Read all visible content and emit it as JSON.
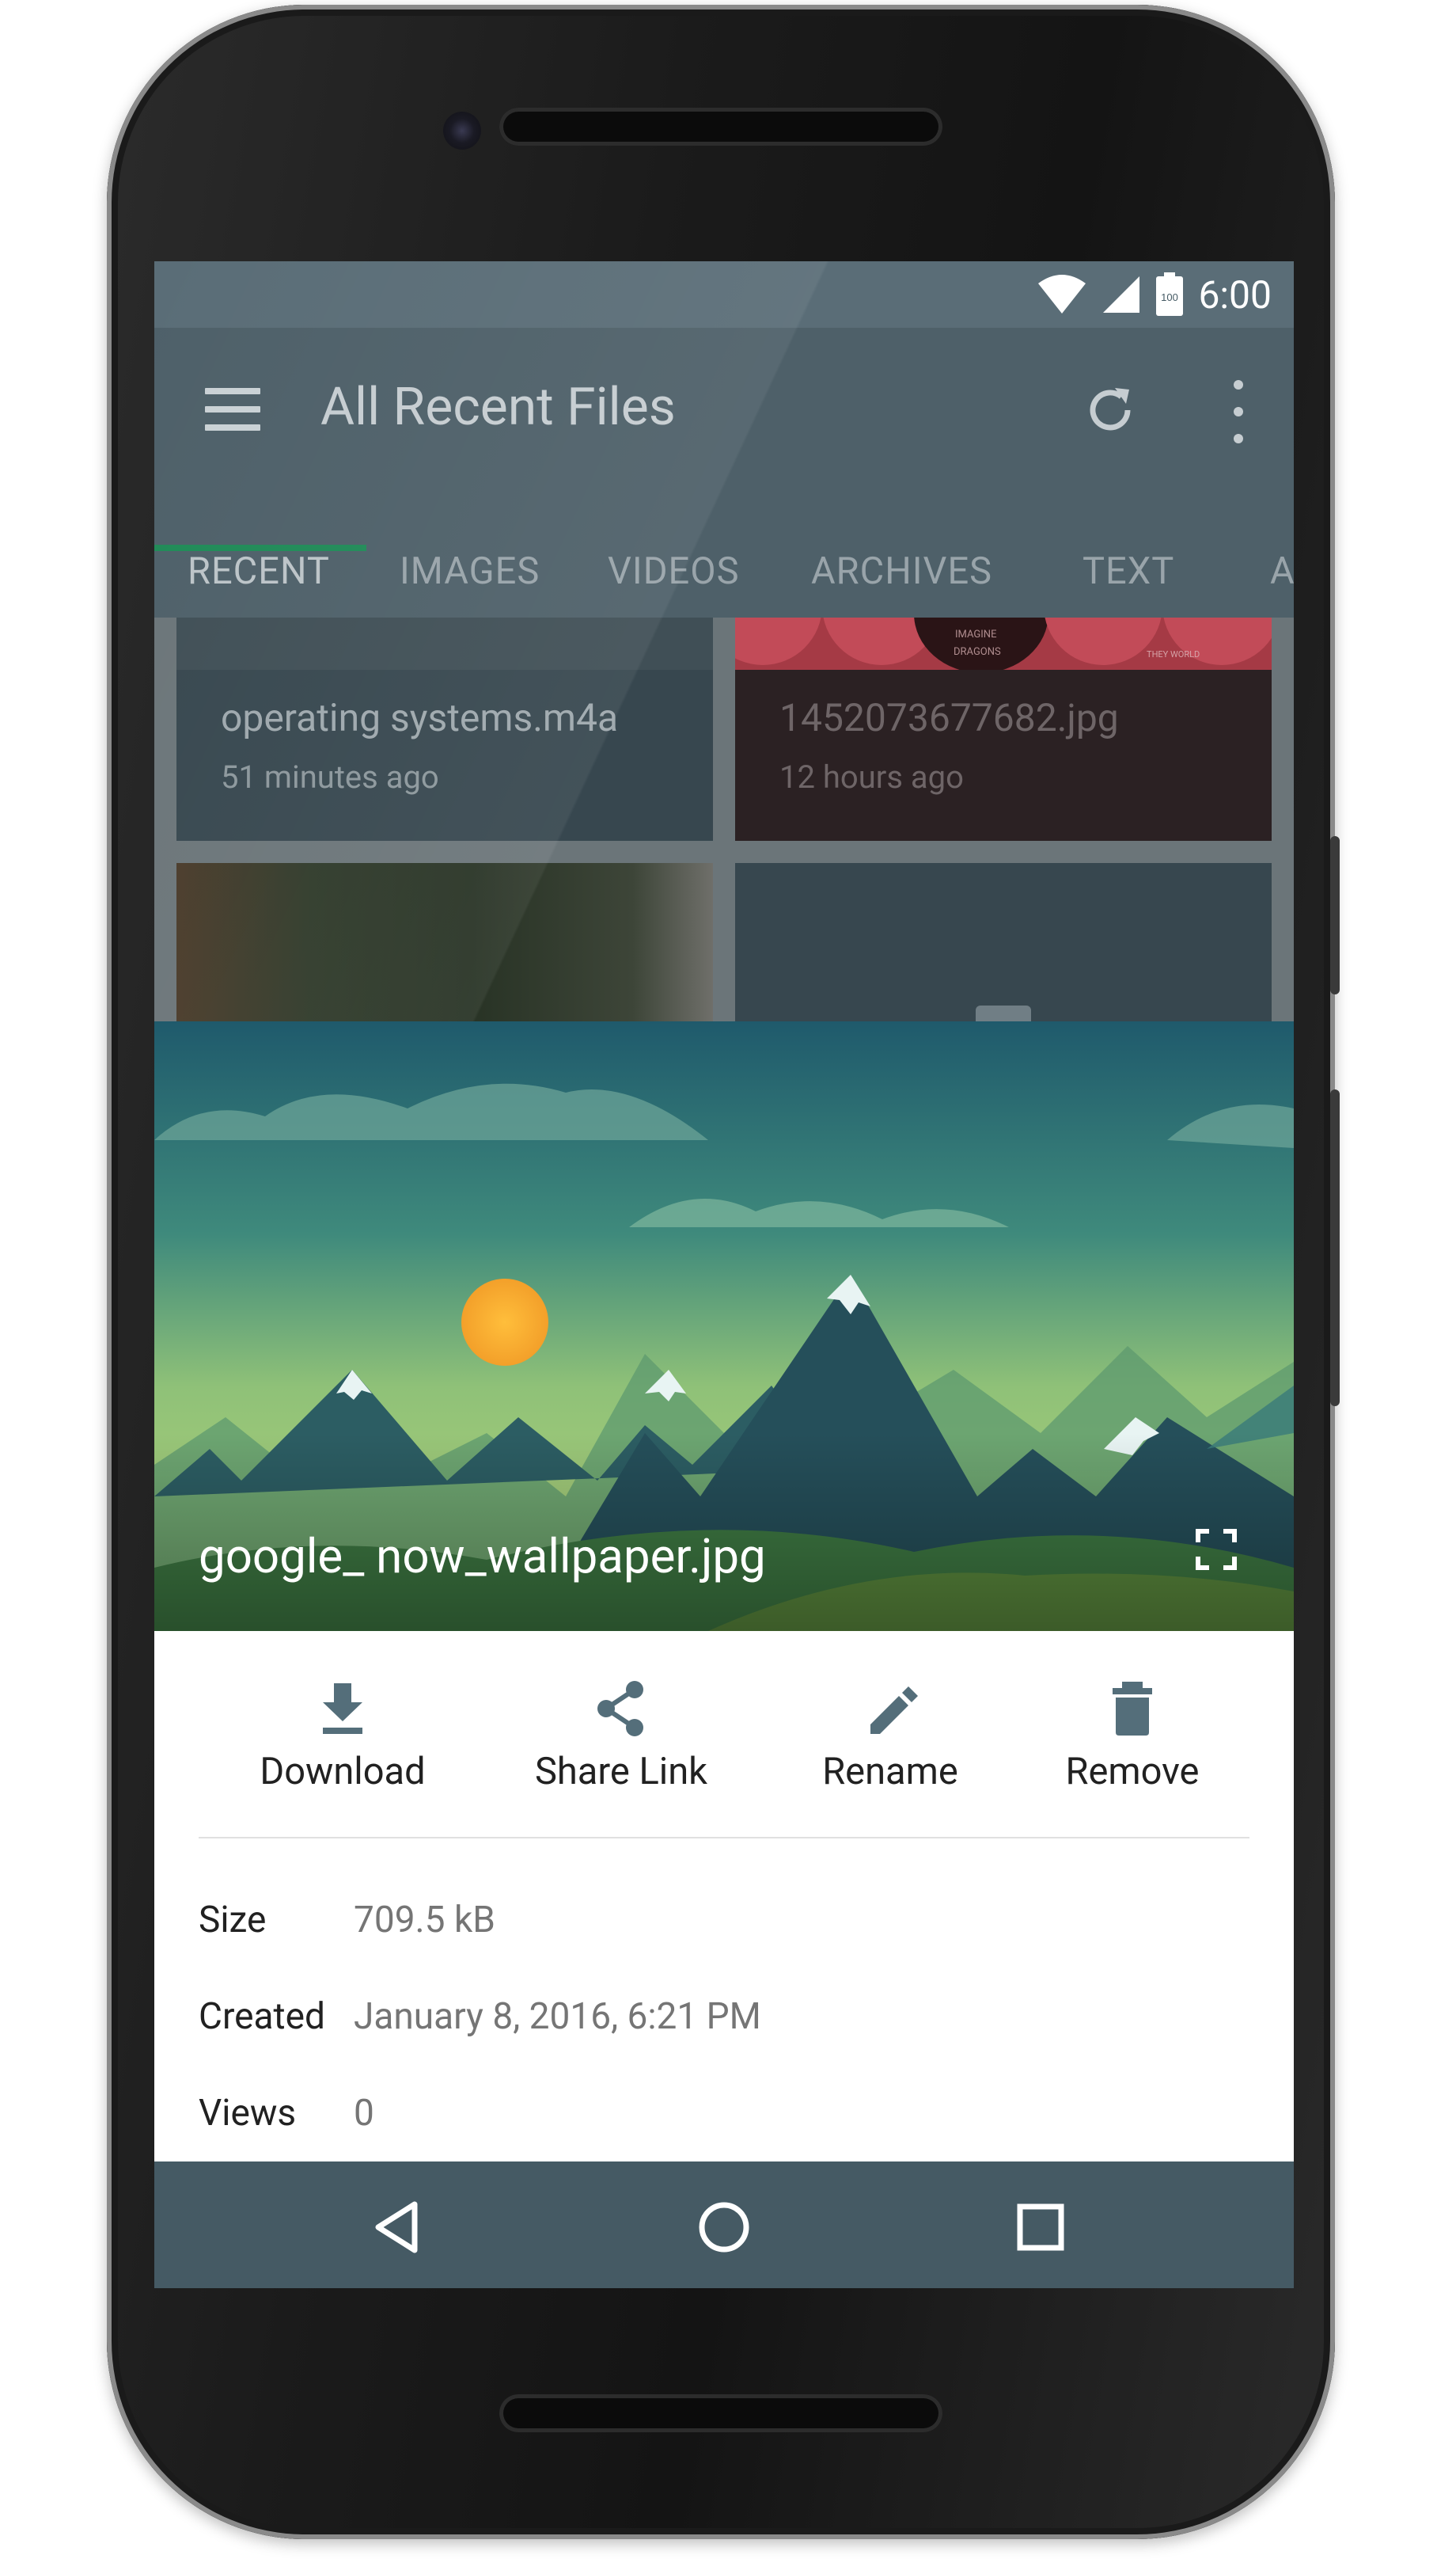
{
  "status_bar": {
    "time": "6:00",
    "battery_level": "100"
  },
  "app_bar": {
    "title": "All Recent Files",
    "menu_icon": "hamburger-menu-icon",
    "refresh_icon": "refresh-icon",
    "overflow_icon": "more-vert-icon"
  },
  "tabs": [
    {
      "label": "RECENT",
      "active": true
    },
    {
      "label": "IMAGES"
    },
    {
      "label": "VIDEOS"
    },
    {
      "label": "ARCHIVES"
    },
    {
      "label": "TEXT"
    },
    {
      "label": "A"
    }
  ],
  "grid": {
    "cards": [
      {
        "title": "operating systems.m4a",
        "subtitle": "51 minutes ago"
      },
      {
        "title": "1452073677682.jpg",
        "subtitle": "12 hours ago",
        "art_text_1": "IMAGINE",
        "art_text_2": "DRAGONS",
        "art_text_3": "THEY WORLD"
      }
    ]
  },
  "viewer": {
    "file_name": "google_ now_wallpaper.jpg",
    "fullscreen_icon": "fullscreen-icon"
  },
  "actions": [
    {
      "label": "Download",
      "icon": "download-icon"
    },
    {
      "label": "Share Link",
      "icon": "share-icon"
    },
    {
      "label": "Rename",
      "icon": "edit-pencil-icon"
    },
    {
      "label": "Remove",
      "icon": "delete-icon"
    }
  ],
  "properties": {
    "size_label": "Size",
    "size_value": "709.5 kB",
    "created_label": "Created",
    "created_value": "January 8, 2016, 6:21 PM",
    "views_label": "Views",
    "views_value": "0"
  },
  "nav_bar": {
    "back_icon": "back-triangle-icon",
    "home_icon": "home-circle-icon",
    "recents_icon": "recents-square-icon"
  },
  "colors": {
    "app_bar": "#455a64",
    "tab_indicator": "#1f8a57",
    "sheet_background": "#ffffff"
  }
}
